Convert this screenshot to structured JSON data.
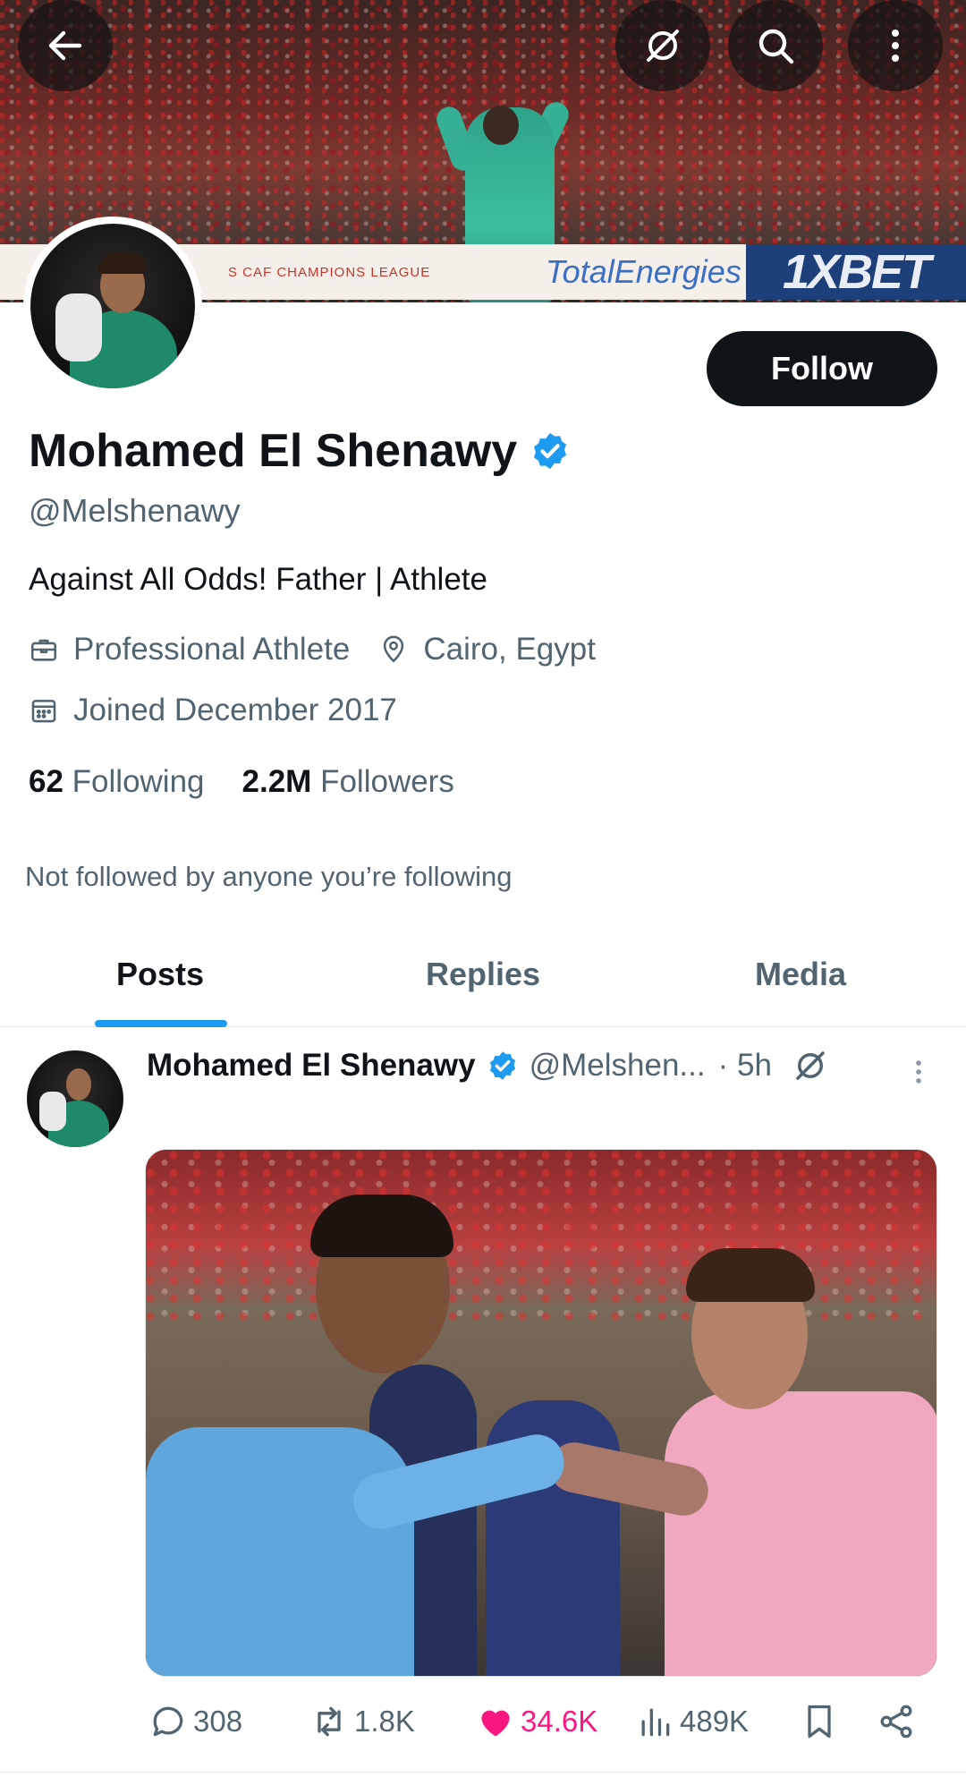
{
  "banner": {
    "ad_board_caf": "S   CAF CHAMPIONS LEAGUE",
    "ad_board_total": "TotalEnergies",
    "ad_board_bet": "1XBET"
  },
  "profile": {
    "display_name": "Mohamed El Shenawy",
    "handle": "@Melshenawy",
    "bio": "Against All Odds! Father | Athlete",
    "category": "Professional Athlete",
    "location": "Cairo, Egypt",
    "joined": "Joined December 2017",
    "following_count": "62",
    "following_label": "Following",
    "followers_count": "2.2M",
    "followers_label": "Followers",
    "mutuals_note": "Not followed by anyone you’re following",
    "follow_button": "Follow"
  },
  "tabs": [
    {
      "label": "Posts",
      "active": true
    },
    {
      "label": "Replies",
      "active": false
    },
    {
      "label": "Media",
      "active": false
    }
  ],
  "post": {
    "author_name": "Mohamed El Shenawy",
    "author_handle": "@Melshen...",
    "time": "· 5h",
    "replies": "308",
    "reposts": "1.8K",
    "likes": "34.6K",
    "views": "489K"
  },
  "colors": {
    "accent": "#1d9bf0",
    "like": "#f91880",
    "text_primary": "#0f1419",
    "text_secondary": "#536471"
  },
  "icons": {
    "back": "arrow-left-icon",
    "grok": "grok-icon",
    "search": "search-icon",
    "more": "more-vertical-icon",
    "verified": "verified-badge-icon",
    "category": "briefcase-icon",
    "location": "map-pin-icon",
    "joined": "calendar-icon",
    "reply": "comment-icon",
    "repost": "repost-icon",
    "like": "heart-icon",
    "views": "views-icon",
    "bookmark": "bookmark-icon",
    "share": "share-icon"
  }
}
